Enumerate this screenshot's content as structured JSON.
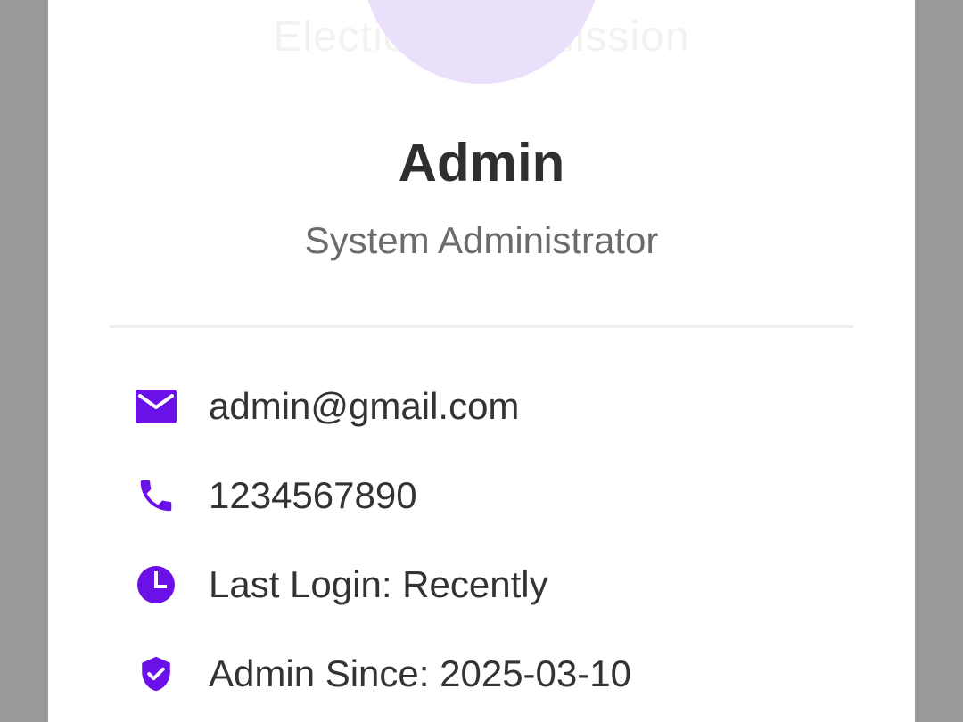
{
  "colors": {
    "accent": "#6a11e8",
    "avatar_bg": "#ebe0fb",
    "scrim": "#999999",
    "name_text": "#2f2f2f",
    "role_text": "#6b6b6b"
  },
  "background": {
    "watermark_text": "Election Commission"
  },
  "profile": {
    "name": "Admin",
    "role": "System Administrator"
  },
  "details": [
    {
      "icon": "mail-icon",
      "text": "admin@gmail.com"
    },
    {
      "icon": "phone-icon",
      "text": "1234567890"
    },
    {
      "icon": "clock-icon",
      "text": "Last Login: Recently"
    },
    {
      "icon": "shield-check-icon",
      "text": "Admin Since: 2025-03-10"
    }
  ]
}
